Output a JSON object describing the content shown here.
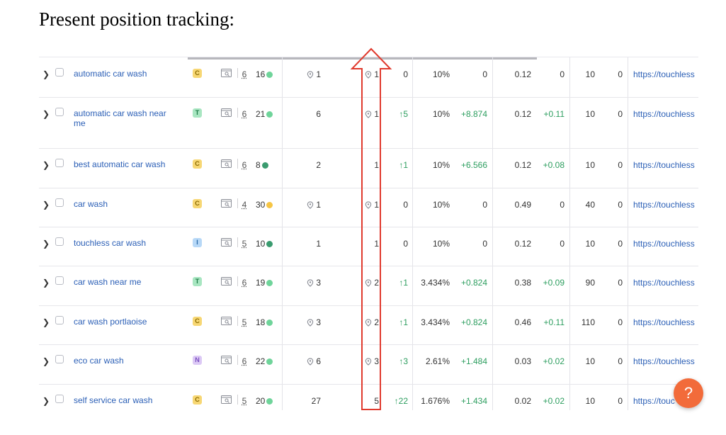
{
  "heading": "Present position tracking:",
  "help_button_label": "?",
  "intent_colors": {
    "C": "#f7d774",
    "T": "#a8e6c1",
    "I": "#b7d8f7",
    "N": "#dcc9f5"
  },
  "intent_text_colors": {
    "C": "#8a6a00",
    "T": "#1f7a48",
    "I": "#2a6aa8",
    "N": "#7a4fc0"
  },
  "dot_colors": {
    "light-green": "#6fd49a",
    "dark-green": "#3a9b6f",
    "yellow": "#f6c544"
  },
  "annotation_color": "#e03a2e",
  "rows": [
    {
      "keyword": "automatic car wash",
      "intent": "C",
      "serp_count": "6",
      "kd": "16",
      "kd_dot": "light-green",
      "pos_prev": "1",
      "pos_prev_pin": true,
      "pos_cur": "1",
      "pos_cur_pin": true,
      "pos_diff": "0",
      "pos_diff_up": false,
      "visibility": "10%",
      "visibility_diff": "0",
      "visibility_diff_up": false,
      "est": "0.12",
      "est_diff": "0",
      "est_diff_up": false,
      "volume": "10",
      "zero": "0",
      "url": "https://touchless"
    },
    {
      "keyword": "automatic car wash near me",
      "intent": "T",
      "serp_count": "6",
      "kd": "21",
      "kd_dot": "light-green",
      "pos_prev": "6",
      "pos_prev_pin": false,
      "pos_cur": "1",
      "pos_cur_pin": true,
      "pos_diff": "↑5",
      "pos_diff_up": true,
      "visibility": "10%",
      "visibility_diff": "+8.874",
      "visibility_diff_up": true,
      "est": "0.12",
      "est_diff": "+0.11",
      "est_diff_up": true,
      "volume": "10",
      "zero": "0",
      "url": "https://touchless"
    },
    {
      "keyword": "best automatic car wash",
      "intent": "C",
      "serp_count": "6",
      "kd": "8",
      "kd_dot": "dark-green",
      "pos_prev": "2",
      "pos_prev_pin": false,
      "pos_cur": "1",
      "pos_cur_pin": false,
      "pos_diff": "↑1",
      "pos_diff_up": true,
      "visibility": "10%",
      "visibility_diff": "+6.566",
      "visibility_diff_up": true,
      "est": "0.12",
      "est_diff": "+0.08",
      "est_diff_up": true,
      "volume": "10",
      "zero": "0",
      "url": "https://touchless"
    },
    {
      "keyword": "car wash",
      "intent": "C",
      "serp_count": "4",
      "kd": "30",
      "kd_dot": "yellow",
      "pos_prev": "1",
      "pos_prev_pin": true,
      "pos_cur": "1",
      "pos_cur_pin": true,
      "pos_diff": "0",
      "pos_diff_up": false,
      "visibility": "10%",
      "visibility_diff": "0",
      "visibility_diff_up": false,
      "est": "0.49",
      "est_diff": "0",
      "est_diff_up": false,
      "volume": "40",
      "zero": "0",
      "url": "https://touchless"
    },
    {
      "keyword": "touchless car wash",
      "intent": "I",
      "serp_count": "5",
      "kd": "10",
      "kd_dot": "dark-green",
      "pos_prev": "1",
      "pos_prev_pin": false,
      "pos_cur": "1",
      "pos_cur_pin": false,
      "pos_diff": "0",
      "pos_diff_up": false,
      "visibility": "10%",
      "visibility_diff": "0",
      "visibility_diff_up": false,
      "est": "0.12",
      "est_diff": "0",
      "est_diff_up": false,
      "volume": "10",
      "zero": "0",
      "url": "https://touchless"
    },
    {
      "keyword": "car wash near me",
      "intent": "T",
      "serp_count": "6",
      "kd": "19",
      "kd_dot": "light-green",
      "pos_prev": "3",
      "pos_prev_pin": true,
      "pos_cur": "2",
      "pos_cur_pin": true,
      "pos_diff": "↑1",
      "pos_diff_up": true,
      "visibility": "3.434%",
      "visibility_diff": "+0.824",
      "visibility_diff_up": true,
      "est": "0.38",
      "est_diff": "+0.09",
      "est_diff_up": true,
      "volume": "90",
      "zero": "0",
      "url": "https://touchless"
    },
    {
      "keyword": "car wash portlaoise",
      "intent": "C",
      "serp_count": "5",
      "kd": "18",
      "kd_dot": "light-green",
      "pos_prev": "3",
      "pos_prev_pin": true,
      "pos_cur": "2",
      "pos_cur_pin": true,
      "pos_diff": "↑1",
      "pos_diff_up": true,
      "visibility": "3.434%",
      "visibility_diff": "+0.824",
      "visibility_diff_up": true,
      "est": "0.46",
      "est_diff": "+0.11",
      "est_diff_up": true,
      "volume": "110",
      "zero": "0",
      "url": "https://touchless"
    },
    {
      "keyword": "eco car wash",
      "intent": "N",
      "serp_count": "6",
      "kd": "22",
      "kd_dot": "light-green",
      "pos_prev": "6",
      "pos_prev_pin": true,
      "pos_cur": "3",
      "pos_cur_pin": true,
      "pos_diff": "↑3",
      "pos_diff_up": true,
      "visibility": "2.61%",
      "visibility_diff": "+1.484",
      "visibility_diff_up": true,
      "est": "0.03",
      "est_diff": "+0.02",
      "est_diff_up": true,
      "volume": "10",
      "zero": "0",
      "url": "https://touchless"
    },
    {
      "keyword": "self service car wash",
      "intent": "C",
      "serp_count": "5",
      "kd": "20",
      "kd_dot": "light-green",
      "pos_prev": "27",
      "pos_prev_pin": false,
      "pos_cur": "5",
      "pos_cur_pin": false,
      "pos_diff": "↑22",
      "pos_diff_up": true,
      "visibility": "1.676%",
      "visibility_diff": "+1.434",
      "visibility_diff_up": true,
      "est": "0.02",
      "est_diff": "+0.02",
      "est_diff_up": true,
      "volume": "10",
      "zero": "0",
      "url": "https://touc"
    }
  ]
}
